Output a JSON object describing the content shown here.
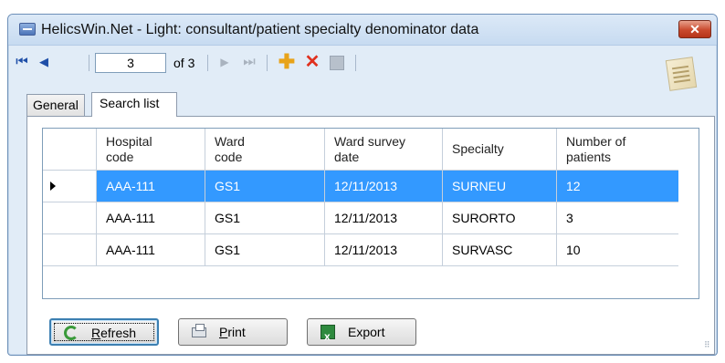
{
  "window": {
    "title": "HelicsWin.Net - Light: consultant/patient specialty denominator data",
    "close_label": "✕"
  },
  "toolbar": {
    "first_icon": "⏮",
    "prev_icon": "◀",
    "current_record": "3",
    "of_text": "of 3",
    "next_icon": "▶",
    "last_icon": "⏭",
    "add_icon": "✚",
    "delete_icon": "✕"
  },
  "tabs": [
    {
      "label": "General"
    },
    {
      "label": "Search list"
    }
  ],
  "grid": {
    "columns": [
      "Hospital code",
      "Ward code",
      "Ward survey date",
      "Specialty",
      "Number of patients"
    ],
    "column_lines": [
      [
        "Hospital",
        "code"
      ],
      [
        "Ward",
        "code"
      ],
      [
        "Ward survey",
        "date"
      ],
      [
        "Specialty"
      ],
      [
        "Number of",
        "patients"
      ]
    ],
    "rows": [
      {
        "hospital_code": "AAA-111",
        "ward_code": "GS1",
        "date": "12/11/2013",
        "specialty": "SURNEU",
        "patients": "12",
        "selected": true
      },
      {
        "hospital_code": "AAA-111",
        "ward_code": "GS1",
        "date": "12/11/2013",
        "specialty": "SURORTO",
        "patients": "3",
        "selected": false
      },
      {
        "hospital_code": "AAA-111",
        "ward_code": "GS1",
        "date": "12/11/2013",
        "specialty": "SURVASC",
        "patients": "10",
        "selected": false
      }
    ],
    "selection_color": "#3399ff"
  },
  "buttons": {
    "refresh": {
      "mnemonic": "R",
      "rest": "efresh"
    },
    "print": {
      "mnemonic": "P",
      "rest": "rint"
    },
    "export": {
      "mnemonic": "",
      "rest": "Export"
    }
  }
}
